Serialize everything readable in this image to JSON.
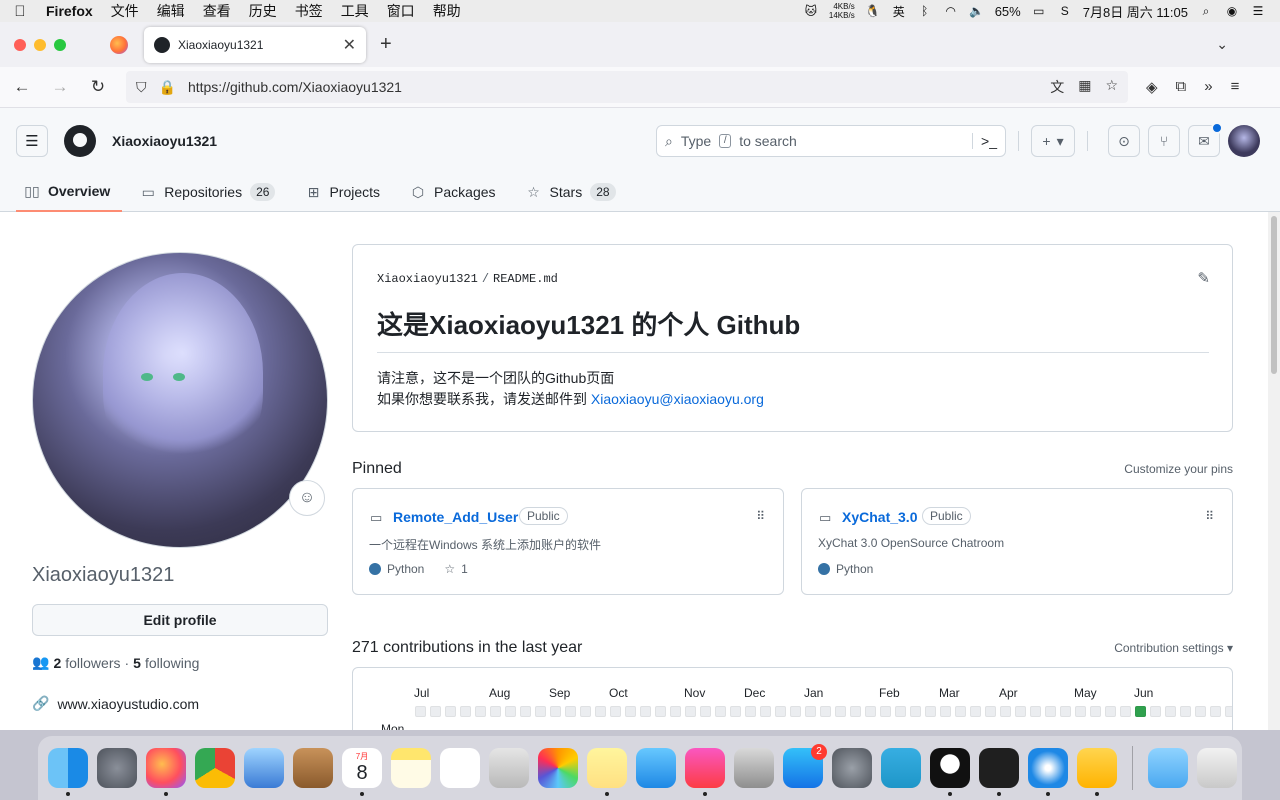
{
  "menubar": {
    "app": "Firefox",
    "items": [
      "文件",
      "编辑",
      "查看",
      "历史",
      "书签",
      "工具",
      "窗口",
      "帮助"
    ],
    "net_up": "4KB/s",
    "net_down": "14KB/s",
    "input_method": "英",
    "battery": "65%",
    "datetime": "7月8日 周六 11:05"
  },
  "browser": {
    "tab_title": "Xiaoxiaoyu1321",
    "url": "https://github.com/Xiaoxiaoyu1321"
  },
  "github": {
    "username": "Xiaoxiaoyu1321",
    "search_placeholder_pre": "Type",
    "search_key": "/",
    "search_placeholder_post": "to search",
    "tabs": [
      {
        "label": "Overview",
        "count": ""
      },
      {
        "label": "Repositories",
        "count": "26"
      },
      {
        "label": "Projects",
        "count": ""
      },
      {
        "label": "Packages",
        "count": ""
      },
      {
        "label": "Stars",
        "count": "28"
      }
    ]
  },
  "profile": {
    "name": "Xiaoxiaoyu1321",
    "edit_label": "Edit profile",
    "followers": "2",
    "followers_label": "followers",
    "following": "5",
    "following_label": "following",
    "website": "www.xiaoyustudio.com"
  },
  "readme": {
    "owner": "Xiaoxiaoyu1321",
    "file": "README.md",
    "title": "这是Xiaoxiaoyu1321 的个人 Github",
    "line1": "请注意，这不是一个团队的Github页面",
    "line2_prefix": "如果你想要联系我，请发送邮件到",
    "email": "Xiaoxiaoyu@xiaoxiaoyu.org"
  },
  "pinned": {
    "heading": "Pinned",
    "customize": "Customize your pins",
    "repos": [
      {
        "name": "Remote_Add_User",
        "visibility": "Public",
        "description": "一个远程在Windows 系统上添加账户的软件",
        "language": "Python",
        "stars": "1"
      },
      {
        "name": "XyChat_3.0",
        "visibility": "Public",
        "description": "XyChat 3.0 OpenSource Chatroom",
        "language": "Python",
        "stars": ""
      }
    ]
  },
  "contributions": {
    "heading": "271 contributions in the last year",
    "settings": "Contribution settings",
    "months": [
      "Jul",
      "Aug",
      "Sep",
      "Oct",
      "Nov",
      "Dec",
      "Jan",
      "Feb",
      "Mar",
      "Apr",
      "May",
      "Jun"
    ],
    "day_label": "Mon",
    "level_colors": [
      "#ebedf0",
      "#9be9a8",
      "#40c463",
      "#30a14e",
      "#216e39"
    ]
  },
  "dock": {
    "apps": [
      "finder-icon",
      "launchpad-icon",
      "firefox-icon",
      "chrome-icon",
      "preview-icon",
      "contacts-icon",
      "calendar-icon",
      "notes-icon",
      "reminders-icon",
      "photo-booth-icon",
      "photos-icon",
      "stickies-icon",
      "messages-icon",
      "music-icon",
      "screenshot-icon",
      "app-store-icon",
      "system-preferences-icon",
      "telegram-icon",
      "qq-icon",
      "terminal-icon",
      "safari-icon",
      "custom-app-icon"
    ],
    "calendar_month": "7月",
    "calendar_day": "8",
    "appstore_badge": "2"
  }
}
